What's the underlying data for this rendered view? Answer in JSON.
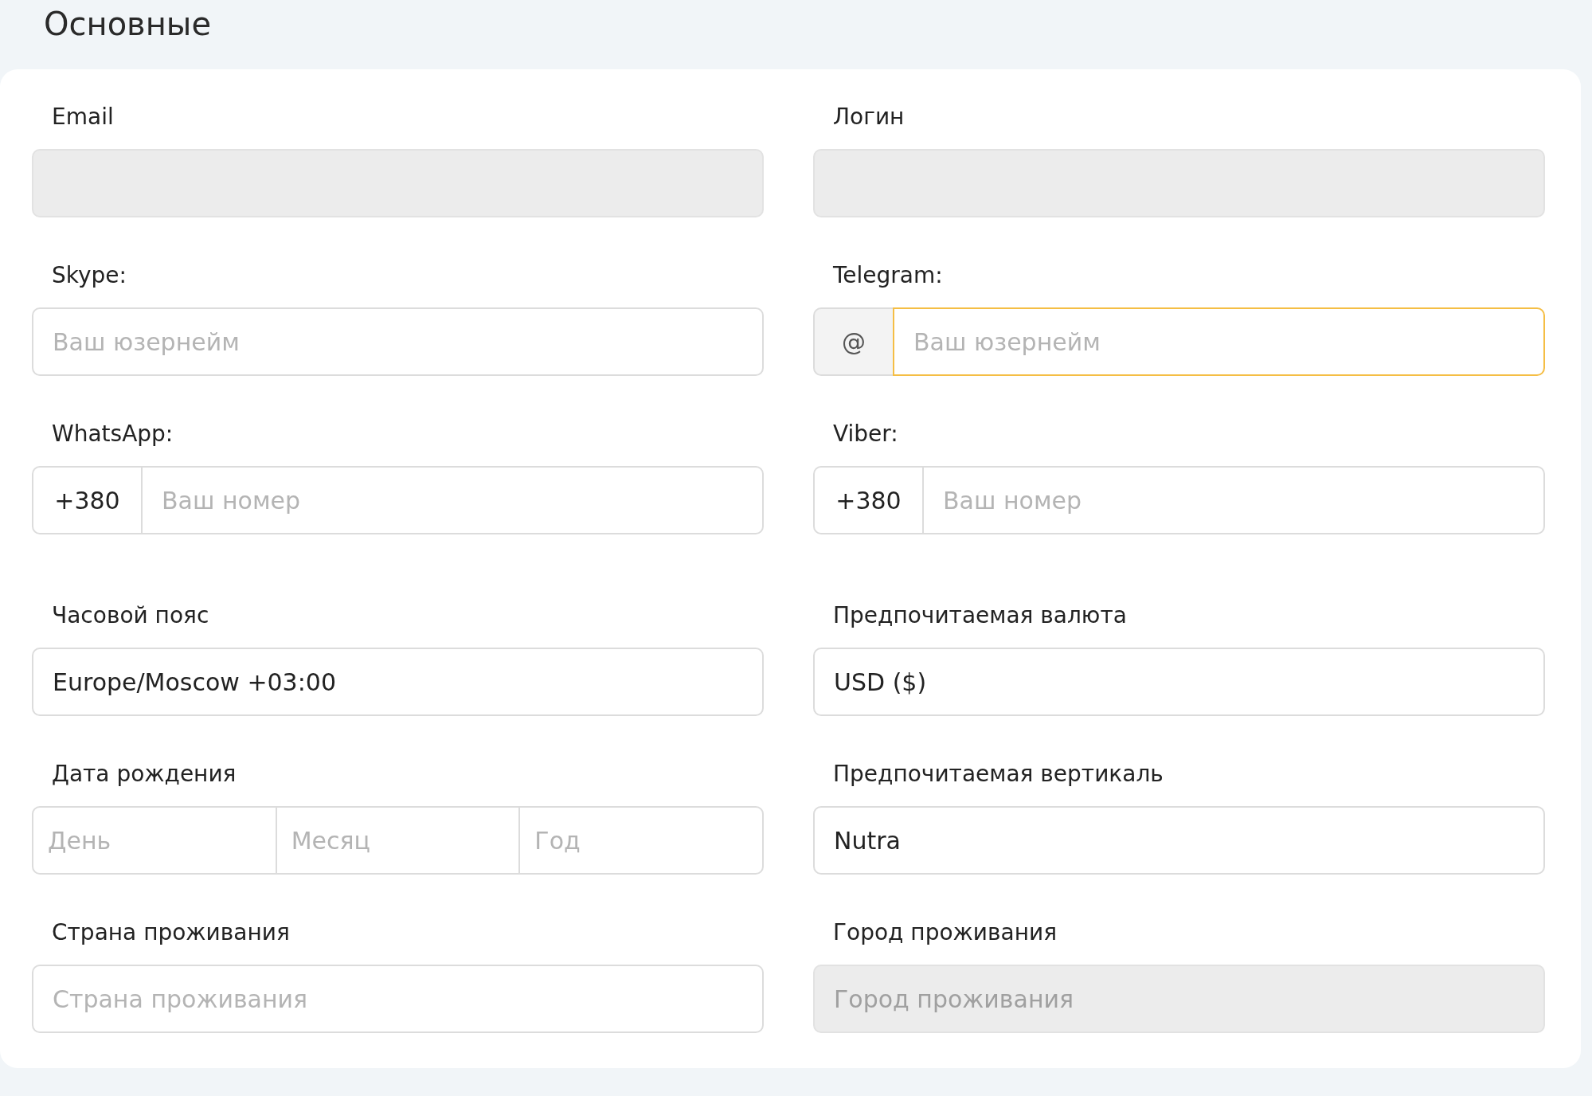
{
  "section_title": "Основные",
  "groups": [
    {
      "fields": [
        {
          "kind": "text",
          "label": "Email",
          "disabled": true,
          "focused": false
        },
        {
          "kind": "text",
          "label": "Логин",
          "disabled": true,
          "focused": false
        },
        {
          "kind": "text",
          "label": "Skype:",
          "placeholder": "Ваш юзернейм",
          "disabled": false,
          "focused": false
        },
        {
          "kind": "addon",
          "label": "Telegram:",
          "prefix": "@",
          "placeholder": "Ваш юзернейм",
          "disabled": false,
          "focused": true
        },
        {
          "kind": "phone",
          "label": "WhatsApp:",
          "prefix": "+380",
          "placeholder": "Ваш номер",
          "disabled": false,
          "focused": false
        },
        {
          "kind": "phone",
          "label": "Viber:",
          "prefix": "+380",
          "placeholder": "Ваш номер",
          "disabled": false,
          "focused": false
        }
      ]
    },
    {
      "fields": [
        {
          "kind": "select",
          "label": "Часовой пояс",
          "value": "Europe/Moscow +03:00",
          "disabled": false,
          "focused": false
        },
        {
          "kind": "select",
          "label": "Предпочитаемая валюта",
          "value": "USD ($)",
          "disabled": false,
          "focused": false
        },
        {
          "kind": "date",
          "label": "Дата рождения",
          "placeholders": [
            "День",
            "Месяц",
            "Год"
          ],
          "disabled": false,
          "focused": false
        },
        {
          "kind": "select",
          "label": "Предпочитаемая вертикаль",
          "value": "Nutra",
          "disabled": false,
          "focused": false
        },
        {
          "kind": "text",
          "label": "Страна проживания",
          "placeholder": "Страна проживания",
          "disabled": false,
          "focused": false
        },
        {
          "kind": "text",
          "label": "Город проживания",
          "placeholder": "Город проживания",
          "disabled": true,
          "focused": false
        }
      ]
    }
  ]
}
